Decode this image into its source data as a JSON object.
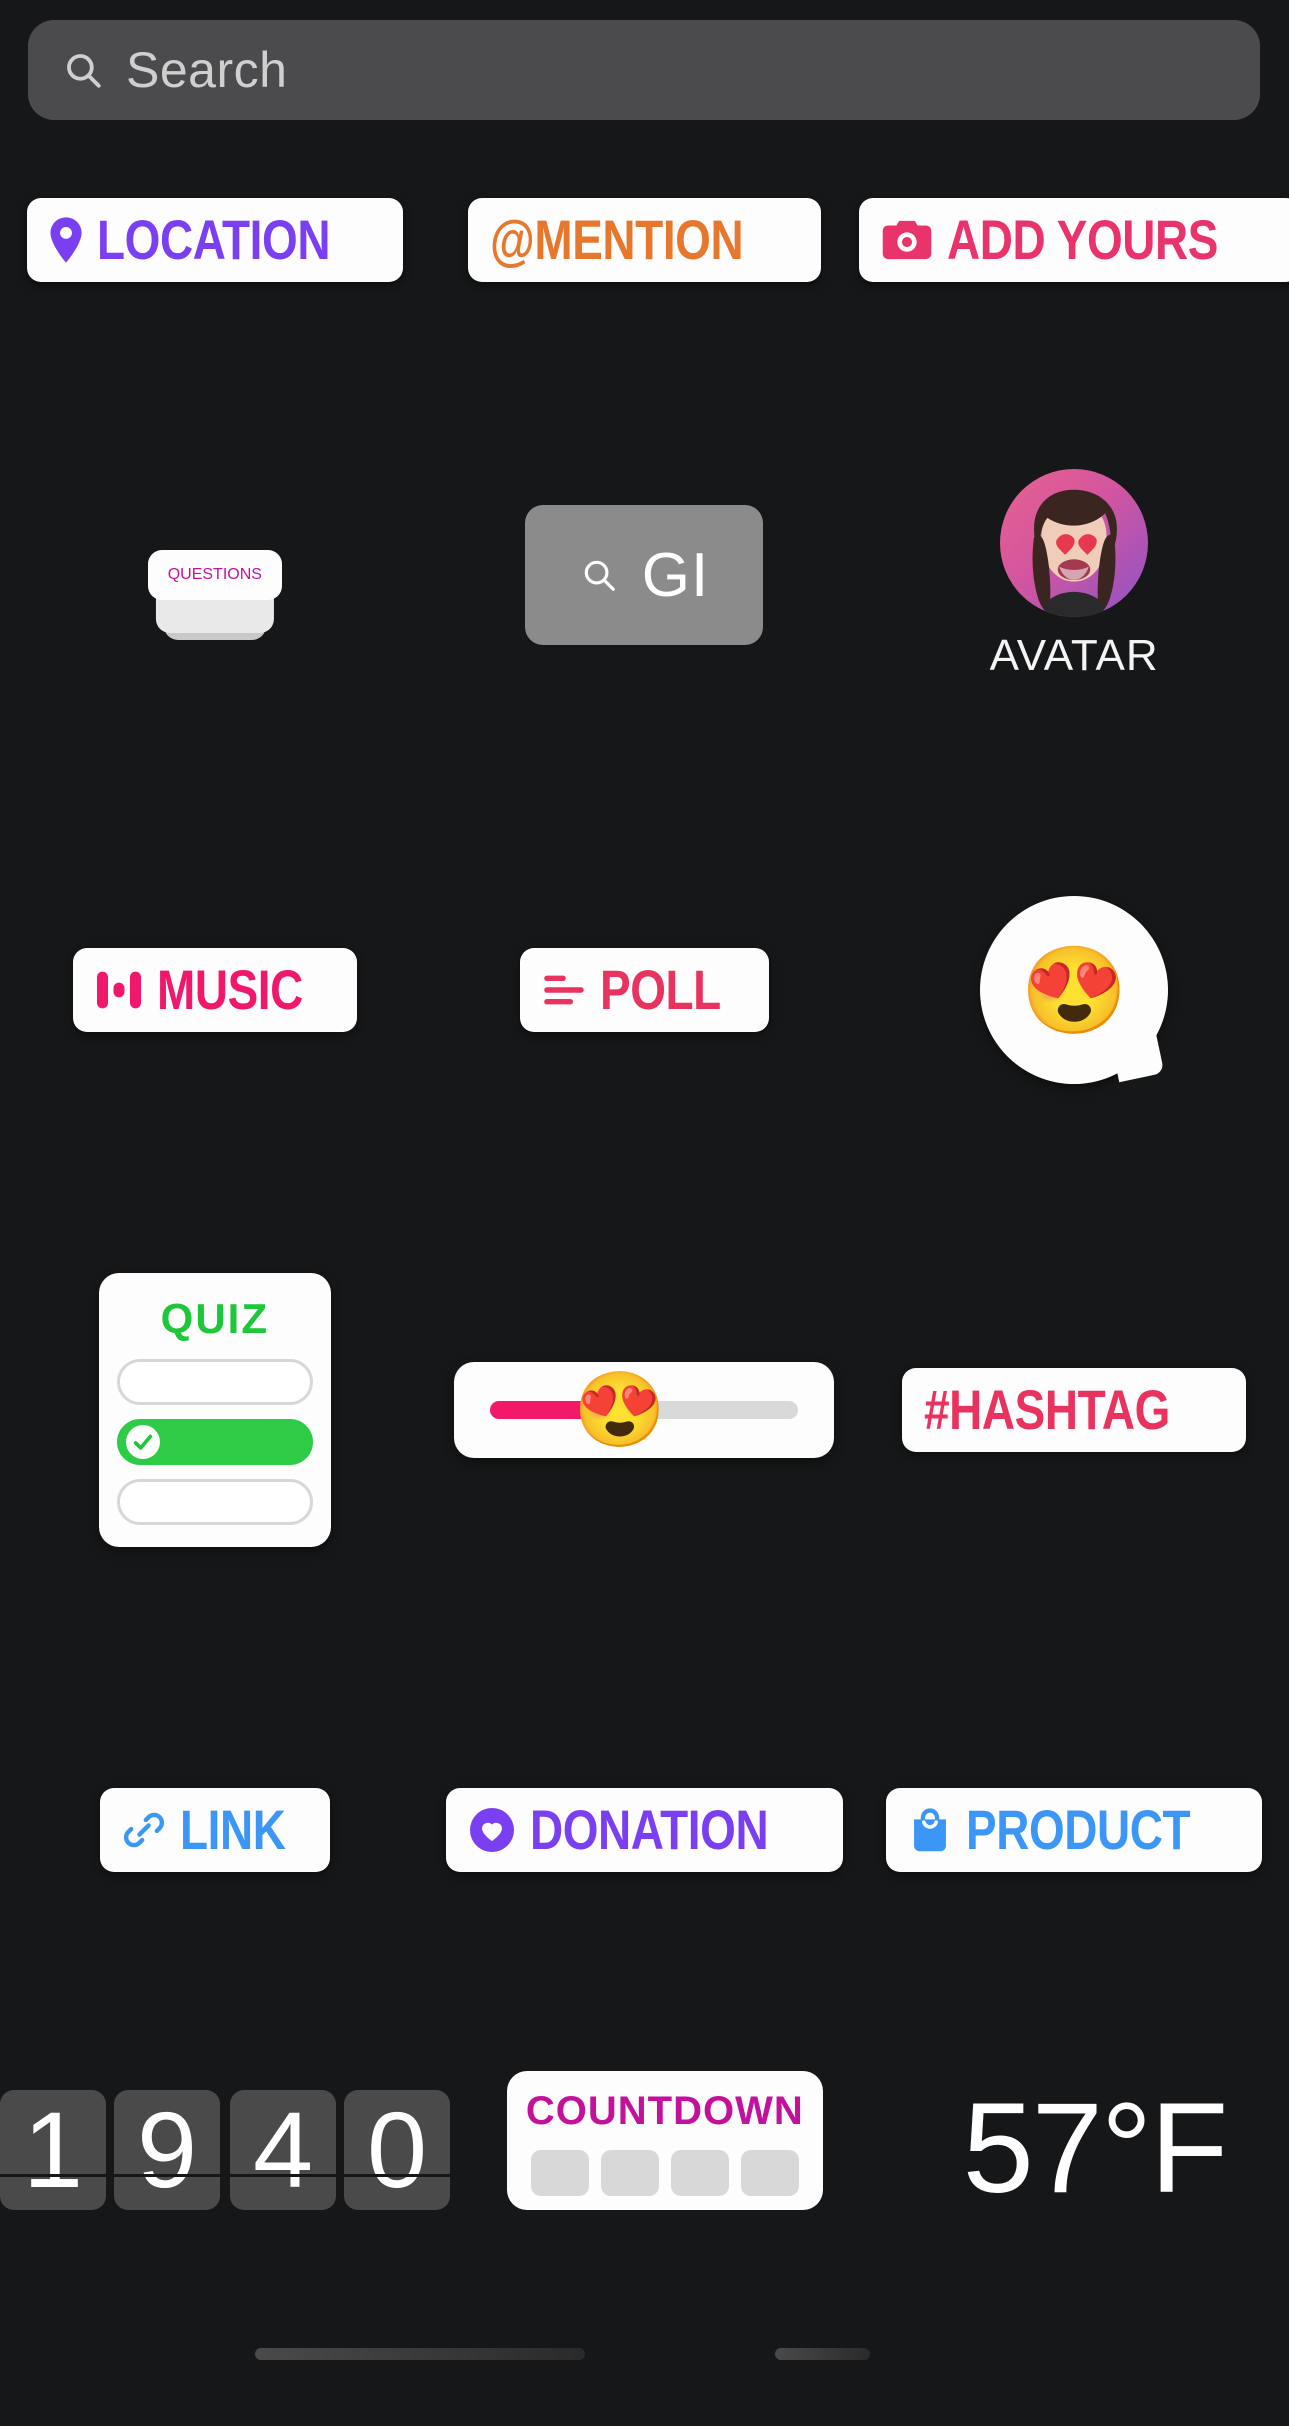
{
  "search": {
    "placeholder": "Search",
    "value": "",
    "icon": "search-icon"
  },
  "stickers": {
    "row1": [
      {
        "id": "location",
        "label": "LOCATION",
        "color": "#7B3FF2",
        "icon": "map-pin-icon"
      },
      {
        "id": "mention",
        "label": "@MENTION",
        "color": "#E8772E",
        "icon": "at-symbol-icon"
      },
      {
        "id": "add-yours",
        "label": "ADD YOURS",
        "color": "#E8336B",
        "icon": "camera-icon"
      }
    ],
    "row2": {
      "questions": {
        "label": "QUESTIONS",
        "color": "#C4119C"
      },
      "gif": {
        "label": "GI",
        "color": "#FFFFFF",
        "background": "#8B8B8B",
        "icon": "search-icon"
      },
      "avatar": {
        "label": "AVATAR",
        "emoji": "😍"
      }
    },
    "row3": {
      "music": {
        "label": "MUSIC",
        "color": "#F0186B",
        "icon": "equalizer-icon"
      },
      "poll": {
        "label": "POLL",
        "color": "#E8335F",
        "icon": "poll-bars-icon"
      },
      "reaction": {
        "emoji": "😍"
      }
    },
    "row4": {
      "quiz": {
        "title": "QUIZ",
        "color": "#1EC639",
        "options": [
          {
            "selected": false
          },
          {
            "selected": true
          },
          {
            "selected": false
          }
        ]
      },
      "slider": {
        "emoji": "😍",
        "fill_percent": 42,
        "fill_color": "#F2196B",
        "track_color": "#D9D9D9"
      },
      "hashtag": {
        "label": "#HASHTAG",
        "color": "#E8335F"
      }
    },
    "row5": [
      {
        "id": "link",
        "label": "LINK",
        "color": "#3B96F5",
        "icon": "chain-link-icon"
      },
      {
        "id": "donation",
        "label": "DONATION",
        "color": "#7B3FF2",
        "icon": "heart-circle-icon"
      },
      {
        "id": "product",
        "label": "PRODUCT",
        "color": "#3B96F5",
        "icon": "shopping-bag-icon"
      }
    ],
    "row6": {
      "clock": {
        "digits": [
          "1",
          "9",
          "4",
          "0"
        ]
      },
      "countdown": {
        "label": "COUNTDOWN",
        "color": "#C4119C",
        "tiles": 4
      },
      "temperature": {
        "label": "57°F"
      }
    }
  }
}
